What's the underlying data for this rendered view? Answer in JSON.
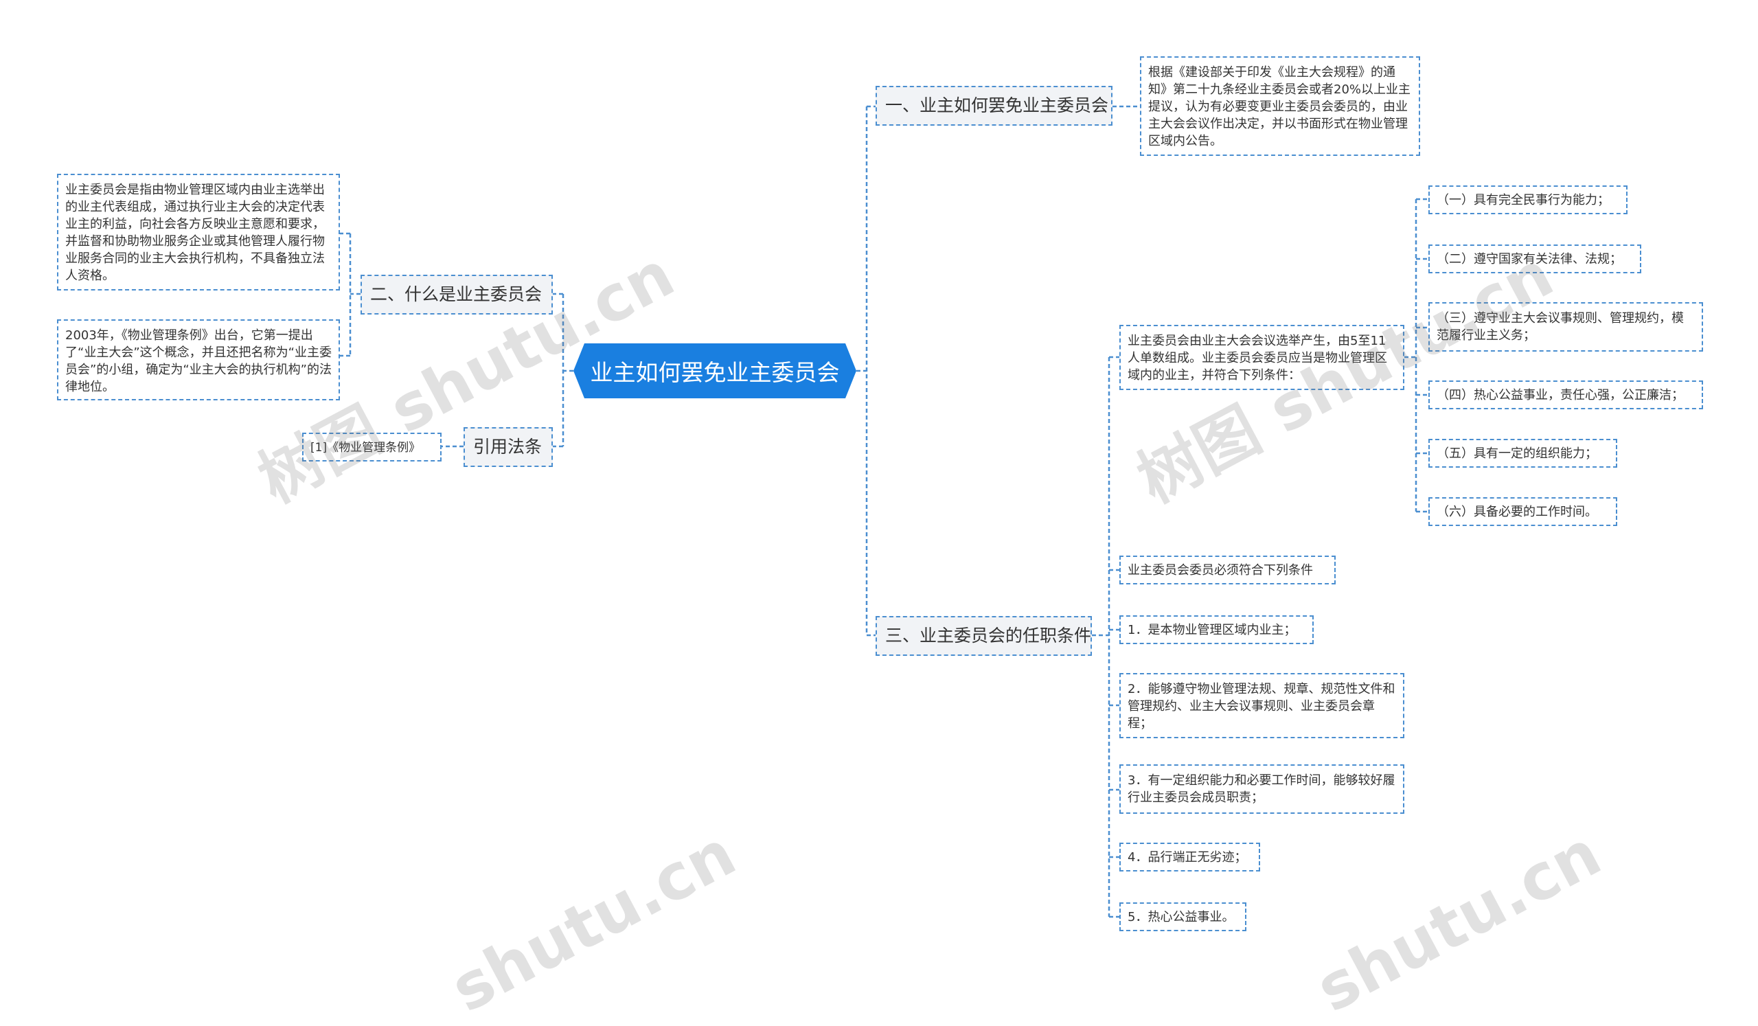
{
  "root": {
    "label": "业主如何罢免业主委员会"
  },
  "branches": {
    "b1": {
      "label": "一、业主如何罢免业主委员会"
    },
    "b2": {
      "label": "二、什么是业主委员会"
    },
    "b3": {
      "label": "三、业主委员会的任职条件"
    },
    "b4": {
      "label": "引用法条"
    }
  },
  "leaves": {
    "b1_text": "根据《建设部关于印发《业主大会规程》的通知》第二十九条经业主委员会或者20%以上业主提议，认为有必要变更业主委员会委员的，由业主大会会议作出决定，并以书面形式在物业管理区域内公告。",
    "b2_text1": "业主委员会是指由物业管理区域内由业主选举出的业主代表组成，通过执行业主大会的决定代表业主的利益，向社会各方反映业主意愿和要求，并监督和协助物业服务企业或其他管理人履行物业服务合同的业主大会执行机构，不具备独立法人资格。",
    "b2_text2": "2003年，《物业管理条例》出台，它第一提出了“业主大会”这个概念，并且还把名称为“业主委员会”的小组，确定为“业主大会的执行机构”的法律地位。",
    "b3_intro": "业主委员会由业主大会会议选举产生，由5至11人单数组成。业主委员会委员应当是物业管理区域内的业主，并符合下列条件：",
    "b3_conditions": [
      "（一）具有完全民事行为能力；",
      "（二）遵守国家有关法律、法规；",
      "（三）遵守业主大会议事规则、管理规约，模范履行业主义务；",
      "（四）热心公益事业，责任心强，公正廉洁；",
      "（五）具有一定的组织能力；",
      "（六）具备必要的工作时间。"
    ],
    "b3_must": "业主委员会委员必须符合下列条件",
    "b3_items": [
      "1．是本物业管理区域内业主；",
      "2．能够遵守物业管理法规、规章、规范性文件和管理规约、业主大会议事规则、业主委员会章程；",
      "3．有一定组织能力和必要工作时间，能够较好履行业主委员会成员职责；",
      "4．品行端正无劣迹；",
      "5．热心公益事业。"
    ],
    "b4_text": "[1]《物业管理条例》"
  },
  "watermarks": [
    "树图 shutu.cn",
    "树图 shutu.cn",
    "shutu.cn",
    "shutu.cn"
  ],
  "colors": {
    "root_fill": "#1a7fe0",
    "line": "#4a8ed0",
    "branch_fill": "#f1f3f6"
  }
}
